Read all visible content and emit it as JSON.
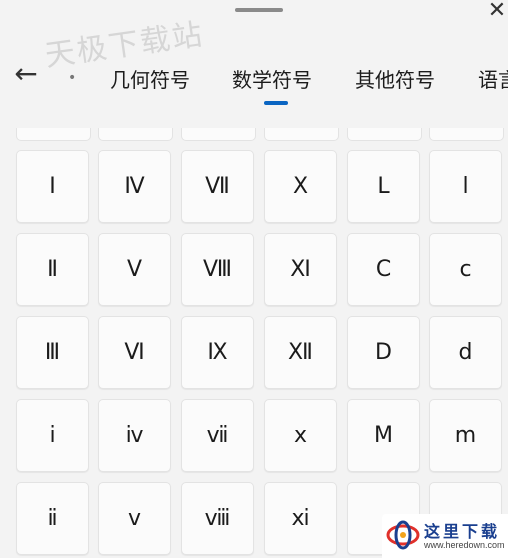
{
  "close_glyph": "✕",
  "watermark": "天极下载站",
  "back_glyph": "←",
  "tabs": [
    {
      "label": "几何符号",
      "selected": false
    },
    {
      "label": "数学符号",
      "selected": true
    },
    {
      "label": "其他符号",
      "selected": false
    },
    {
      "label": "语言",
      "selected": false
    }
  ],
  "accent_color": "#0a65c2",
  "keys": [
    [
      "Ⅰ",
      "Ⅳ",
      "Ⅶ",
      "Ⅹ",
      "Ⅼ",
      "ⅼ"
    ],
    [
      "Ⅱ",
      "Ⅴ",
      "Ⅷ",
      "Ⅺ",
      "Ⅽ",
      "ⅽ"
    ],
    [
      "Ⅲ",
      "Ⅵ",
      "Ⅸ",
      "Ⅻ",
      "Ⅾ",
      "ⅾ"
    ],
    [
      "ⅰ",
      "ⅳ",
      "ⅶ",
      "ⅹ",
      "Ⅿ",
      "ⅿ"
    ],
    [
      "ⅱ",
      "ⅴ",
      "ⅷ",
      "ⅺ",
      "",
      ""
    ]
  ],
  "logo": {
    "name": "这里下载",
    "url": "www.heredown.com"
  }
}
